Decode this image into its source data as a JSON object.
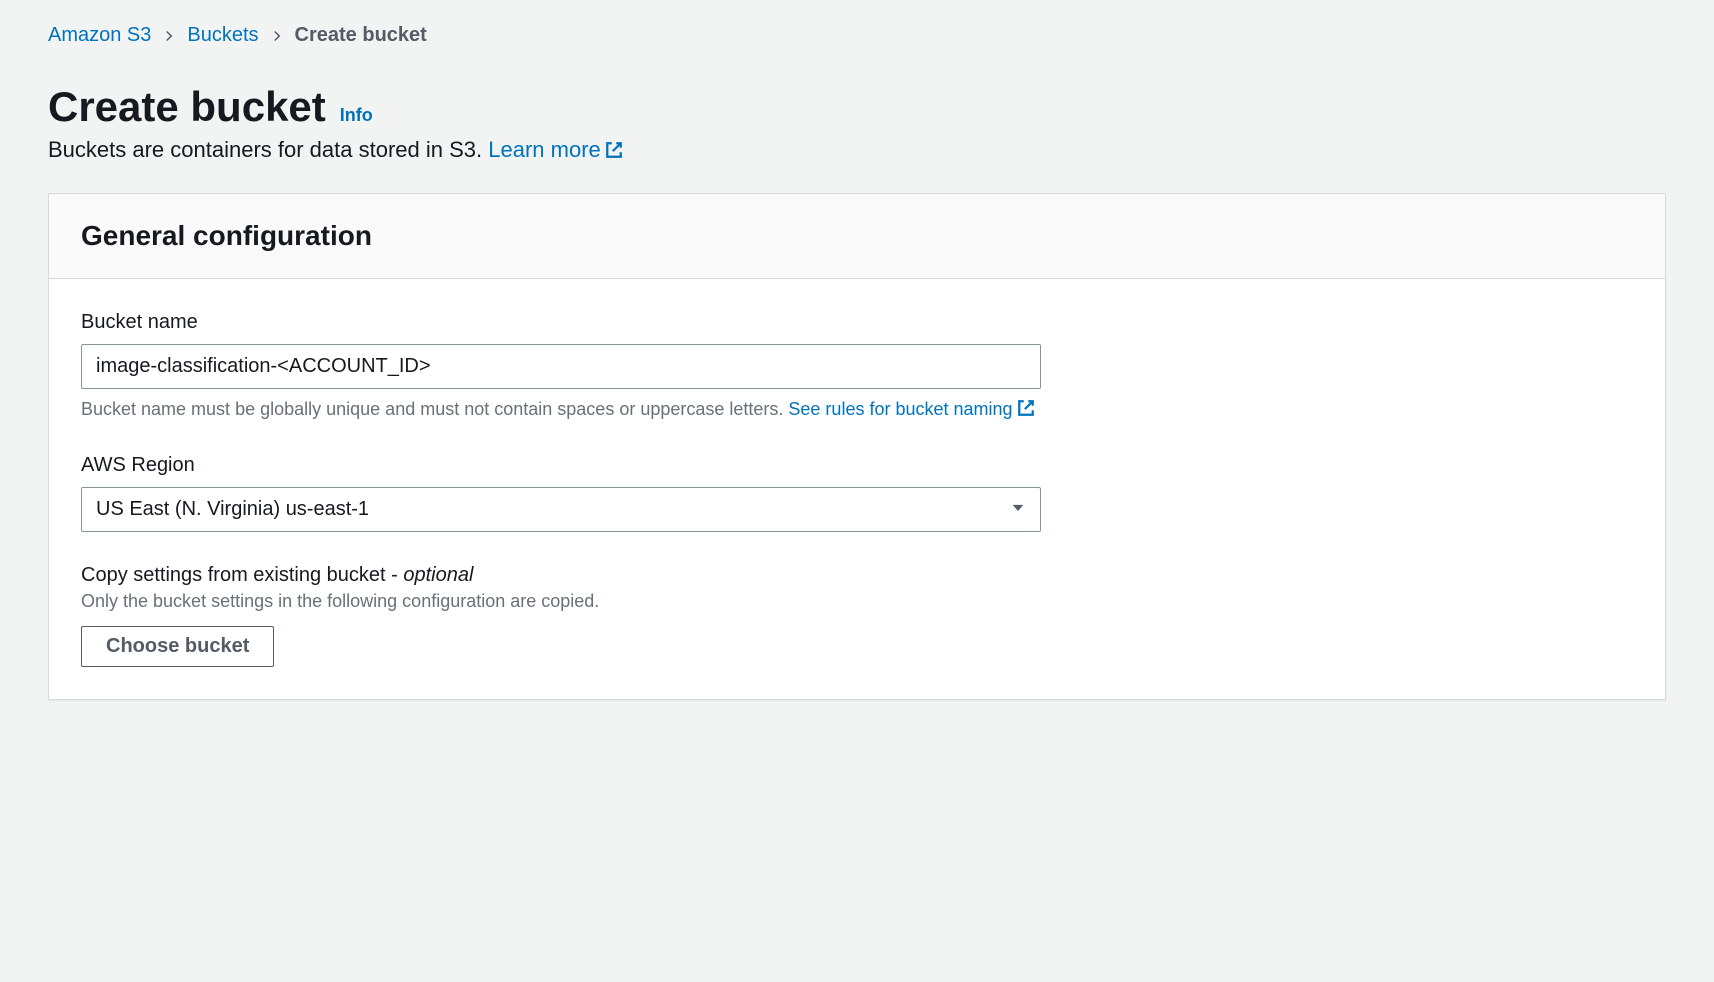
{
  "breadcrumb": {
    "items": [
      {
        "label": "Amazon S3"
      },
      {
        "label": "Buckets"
      }
    ],
    "current": "Create bucket"
  },
  "header": {
    "title": "Create bucket",
    "info_label": "Info",
    "subtitle_text": "Buckets are containers for data stored in S3. ",
    "learn_more_label": "Learn more"
  },
  "panel": {
    "title": "General configuration",
    "bucket_name": {
      "label": "Bucket name",
      "value": "image-classification-<ACCOUNT_ID>",
      "hint_text": "Bucket name must be globally unique and must not contain spaces or uppercase letters. ",
      "rules_link_label": "See rules for bucket naming"
    },
    "region": {
      "label": "AWS Region",
      "selected": "US East (N. Virginia) us-east-1"
    },
    "copy_settings": {
      "label_prefix": "Copy settings from existing bucket - ",
      "optional_label": "optional",
      "hint": "Only the bucket settings in the following configuration are copied.",
      "choose_button_label": "Choose bucket"
    }
  }
}
